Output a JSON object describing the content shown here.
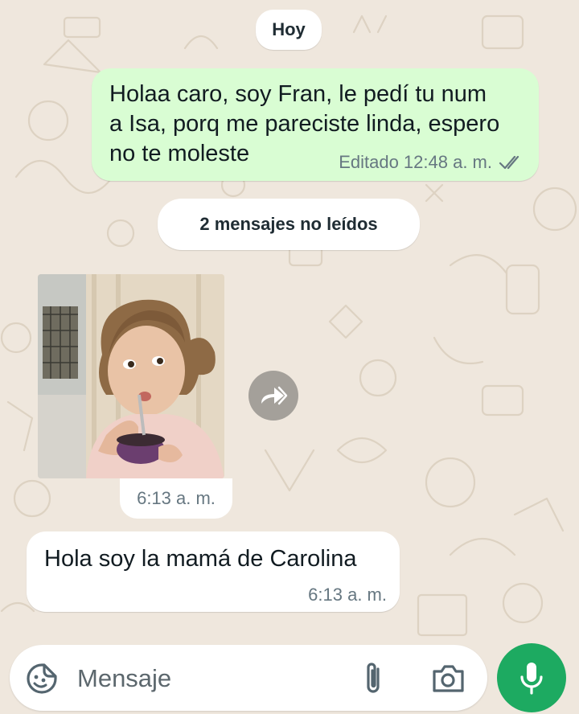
{
  "date_separator": "Hoy",
  "unread_banner": "2 mensajes no leídos",
  "outgoing_message": {
    "text": "Holaa caro, soy Fran, le pedí tu num\na Isa, porq me pareciste linda, espero\nno te moleste",
    "edited_time": "Editado 12:48 a. m.",
    "status_icon": "double-check-icon"
  },
  "incoming_photo": {
    "time": "6:13 a. m."
  },
  "incoming_message": {
    "text": "Hola soy la mamá de Carolina",
    "time": "6:13 a. m."
  },
  "composer": {
    "placeholder": "Mensaje",
    "icons": [
      "sticker-icon",
      "attach-icon",
      "camera-icon",
      "mic-icon"
    ]
  },
  "colors": {
    "background": "#efe7dd",
    "outgoing_bubble": "#d9fdd3",
    "mic_button": "#1daa61"
  }
}
